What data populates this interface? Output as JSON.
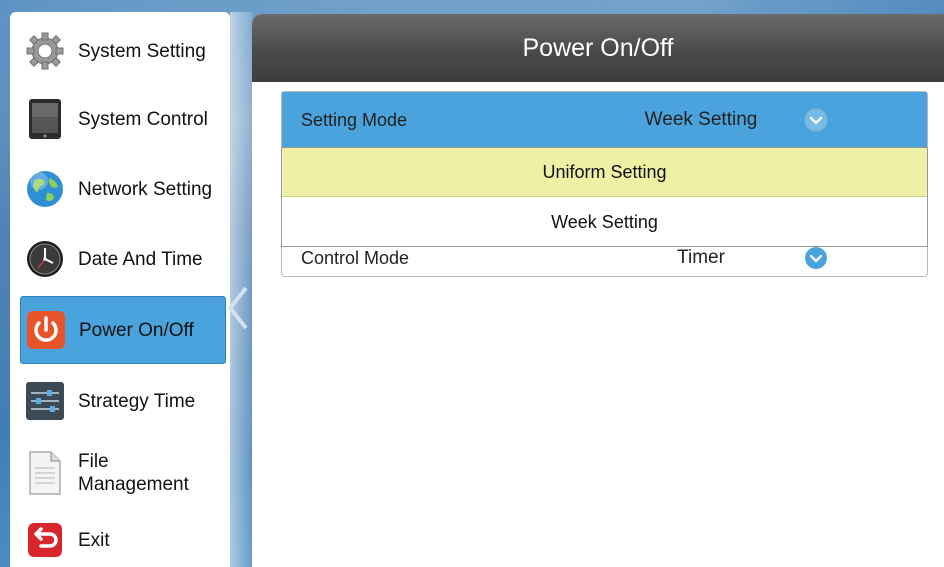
{
  "sidebar": {
    "items": [
      {
        "label": "System Setting",
        "icon": "gear-icon"
      },
      {
        "label": "System Control",
        "icon": "tablet-icon"
      },
      {
        "label": "Network Setting",
        "icon": "globe-icon"
      },
      {
        "label": "Date And Time",
        "icon": "clock-icon"
      },
      {
        "label": "Power On/Off",
        "icon": "power-icon",
        "active": true
      },
      {
        "label": "Strategy Time",
        "icon": "sliders-icon"
      },
      {
        "label": "File Management",
        "icon": "document-icon"
      },
      {
        "label": "Exit",
        "icon": "exit-icon"
      }
    ],
    "file_label_line1": "File",
    "file_label_line2": "Management"
  },
  "main": {
    "title": "Power On/Off",
    "settings": [
      {
        "name": "Setting Mode",
        "value": "Week Setting"
      },
      {
        "name": "Control Mode",
        "value": "Timer"
      }
    ],
    "dropdown": {
      "options": [
        "Uniform Setting",
        "Week Setting"
      ],
      "highlighted": "Uniform Setting"
    }
  },
  "colors": {
    "accent": "#4aa3dc",
    "highlight": "#eef0a6",
    "header": "#4a4a4a",
    "power_icon": "#e8542a",
    "exit_icon": "#d9262c"
  }
}
